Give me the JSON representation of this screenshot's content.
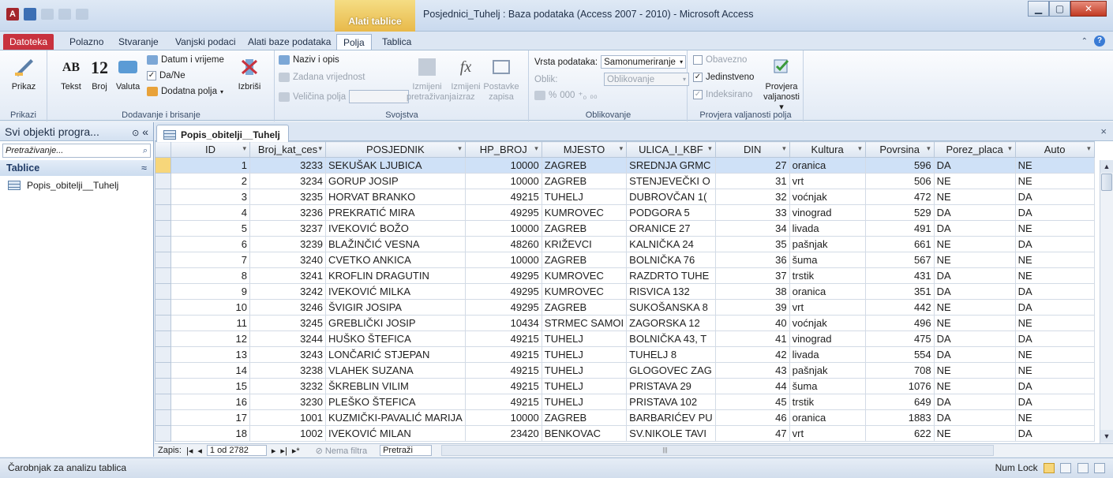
{
  "window": {
    "title": "Posjednici_Tuhelj : Baza podataka (Access 2007 - 2010)  -  Microsoft Access",
    "context_tab": "Alati tablice"
  },
  "ribbon_tabs": [
    "Datoteka",
    "Polazno",
    "Stvaranje",
    "Vanjski podaci",
    "Alati baze podataka",
    "Polja",
    "Tablica"
  ],
  "ribbon": {
    "views": {
      "button": "Prikaz",
      "label": "Prikazi"
    },
    "add_delete": {
      "text": "Tekst",
      "number_glyph": "12",
      "number": "Broj",
      "currency": "Valuta",
      "datetime": "Datum i vrijeme",
      "yesno": "Da/Ne",
      "more_fields": "Dodatna polja",
      "delete": "Izbriši",
      "label": "Dodavanje i brisanje"
    },
    "properties": {
      "name_caption": "Naziv i opis",
      "default_value": "Zadana vrijednost",
      "field_size": "Veličina polja",
      "modify_lookups_1": "Izmijeni",
      "modify_lookups_2": "pretraživanja",
      "modify_expr_1": "Izmijeni",
      "modify_expr_2": "izraz",
      "memo_settings_1": "Postavke",
      "memo_settings_2": "zapisa",
      "label": "Svojstva"
    },
    "formatting": {
      "data_type_label": "Vrsta podataka:",
      "data_type_value": "Samonumeriranje",
      "format_label": "Oblik:",
      "format_value": "Oblikovanje",
      "percent": "%",
      "thousands": "000",
      "label": "Oblikovanje"
    },
    "validation": {
      "required": "Obavezno",
      "unique": "Jedinstveno",
      "indexed": "Indeksirano",
      "validate_1": "Provjera",
      "validate_2": "valjanosti",
      "label": "Provjera valjanosti polja"
    }
  },
  "nav_pane": {
    "title": "Svi objekti progra...",
    "search_placeholder": "Pretraživanje...",
    "category": "Tablice",
    "items": [
      "Popis_obitelji__Tuhelj"
    ]
  },
  "document": {
    "tab_label": "Popis_obitelji__Tuhelj",
    "columns": [
      "ID",
      "Broj_kat_ces",
      "POSJEDNIK",
      "HP_BROJ",
      "MJESTO",
      "ULICA_I_KBF",
      "DIN",
      "Kultura",
      "Povrsina",
      "Porez_placa",
      "Auto"
    ],
    "rows": [
      [
        "1",
        "3233",
        "SEKUŠAK LJUBICA",
        "10000",
        "ZAGREB",
        "SREDNJA GRMC",
        "27",
        "oranica",
        "596",
        "DA",
        "NE"
      ],
      [
        "2",
        "3234",
        "GORUP JOSIP",
        "10000",
        "ZAGREB",
        "STENJEVEČKI O",
        "31",
        "vrt",
        "506",
        "NE",
        "NE"
      ],
      [
        "3",
        "3235",
        "HORVAT BRANKO",
        "49215",
        "TUHELJ",
        "DUBROVČAN 1(",
        "32",
        "voćnjak",
        "472",
        "NE",
        "DA"
      ],
      [
        "4",
        "3236",
        "PREKRATIĆ MIRA",
        "49295",
        "KUMROVEC",
        "PODGORA 5",
        "33",
        "vinograd",
        "529",
        "DA",
        "DA"
      ],
      [
        "5",
        "3237",
        "IVEKOVIĆ BOŽO",
        "10000",
        "ZAGREB",
        "ORANICE 27",
        "34",
        "livada",
        "491",
        "DA",
        "NE"
      ],
      [
        "6",
        "3239",
        "BLAŽINČIĆ VESNA",
        "48260",
        "KRIŽEVCI",
        "KALNIČKA 24",
        "35",
        "pašnjak",
        "661",
        "NE",
        "DA"
      ],
      [
        "7",
        "3240",
        "CVETKO ANKICA",
        "10000",
        "ZAGREB",
        "BOLNIČKA 76",
        "36",
        "šuma",
        "567",
        "NE",
        "NE"
      ],
      [
        "8",
        "3241",
        "KROFLIN DRAGUTIN",
        "49295",
        "KUMROVEC",
        "RAZDRTO TUHE",
        "37",
        "trstik",
        "431",
        "DA",
        "NE"
      ],
      [
        "9",
        "3242",
        "IVEKOVIĆ MILKA",
        "49295",
        "KUMROVEC",
        "RISVICA 132",
        "38",
        "oranica",
        "351",
        "DA",
        "DA"
      ],
      [
        "10",
        "3246",
        "ŠVIGIR JOSIPA",
        "49295",
        "ZAGREB",
        "SUKOŠANSKA 8",
        "39",
        "vrt",
        "442",
        "NE",
        "DA"
      ],
      [
        "11",
        "3245",
        "GREBLIČKI JOSIP",
        "10434",
        "STRMEC SAMOI",
        "ZAGORSKA 12",
        "40",
        "voćnjak",
        "496",
        "NE",
        "NE"
      ],
      [
        "12",
        "3244",
        "HUŠKO ŠTEFICA",
        "49215",
        "TUHELJ",
        "BOLNIČKA 43, T",
        "41",
        "vinograd",
        "475",
        "DA",
        "DA"
      ],
      [
        "13",
        "3243",
        "LONČARIĆ STJEPAN",
        "49215",
        "TUHELJ",
        "TUHELJ 8",
        "42",
        "livada",
        "554",
        "DA",
        "NE"
      ],
      [
        "14",
        "3238",
        "VLAHEK SUZANA",
        "49215",
        "TUHELJ",
        "GLOGOVEC ZAG",
        "43",
        "pašnjak",
        "708",
        "NE",
        "NE"
      ],
      [
        "15",
        "3232",
        "ŠKREBLIN VILIM",
        "49215",
        "TUHELJ",
        "PRISTAVA 29",
        "44",
        "šuma",
        "1076",
        "NE",
        "DA"
      ],
      [
        "16",
        "3230",
        "PLEŠKO ŠTEFICA",
        "49215",
        "TUHELJ",
        "PRISTAVA 102",
        "45",
        "trstik",
        "649",
        "DA",
        "DA"
      ],
      [
        "17",
        "1001",
        "KUZMIČKI-PAVALIĆ MARIJA",
        "10000",
        "ZAGREB",
        "BARBARIĆEV PU",
        "46",
        "oranica",
        "1883",
        "DA",
        "NE"
      ],
      [
        "18",
        "1002",
        "IVEKOVIĆ MILAN",
        "23420",
        "BENKOVAC",
        "SV.NIKOLE TAVI",
        "47",
        "vrt",
        "622",
        "NE",
        "DA"
      ]
    ],
    "selected_row": 0,
    "record_nav": {
      "label": "Zapis:",
      "position": "1 od 2782",
      "filter": "Nema filtra",
      "search": "Pretraži"
    }
  },
  "status_bar": {
    "left": "Čarobnjak za analizu tablica",
    "num_lock": "Num Lock"
  },
  "colors": {
    "file_tab": "#c8323e",
    "context_tab": "#e8b94a",
    "selected_row": "#cfe1f7",
    "record_selector_active": "#f7d67a"
  }
}
